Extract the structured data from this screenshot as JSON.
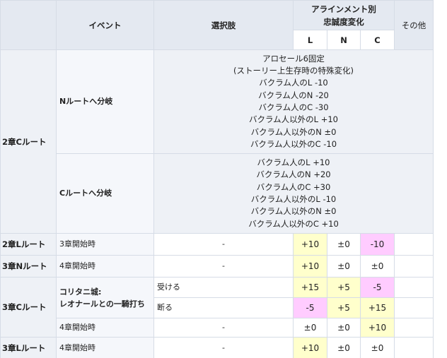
{
  "header": {
    "event": "イベント",
    "choice": "選択肢",
    "alignment_line1": "アラインメント別",
    "alignment_line2": "忠誠度変化",
    "other": "その他",
    "col_l": "L",
    "col_n": "N",
    "col_c": "C"
  },
  "sections": {
    "ch2_c_route": "2章Cルート",
    "ch2_l_route": "2章Lルート",
    "ch3_n_route": "3章Nルート",
    "ch3_c_route": "3章Cルート",
    "ch3_l_route": "3章Lルート"
  },
  "events": {
    "n_route_branch": "Nルートへ分岐",
    "c_route_branch": "Cルートへ分岐",
    "ch3_start": "3章開始時",
    "ch4_start_a": "4章開始時",
    "koritani_line1": "コリタニ城:",
    "koritani_line2": "レオナールとの一騎打ち",
    "ch4_start_b": "4章開始時",
    "ch4_start_c": "4章開始時"
  },
  "notes": {
    "n_branch": [
      "アロセール6固定",
      "(ストーリー上生存時の特殊変化)",
      "バクラム人のL -10",
      "バクラム人のN -20",
      "バクラム人のC -30",
      "バクラム人以外のL +10",
      "バクラム人以外のN ±0",
      "バクラム人以外のC -10"
    ],
    "c_branch": [
      "バクラム人のL +10",
      "バクラム人のN +20",
      "バクラム人のC +30",
      "バクラム人以外のL -10",
      "バクラム人以外のN ±0",
      "バクラム人以外のC +10"
    ]
  },
  "choices": {
    "dash": "-",
    "accept": "受ける",
    "refuse": "断る"
  },
  "rows": {
    "r_ch2l": {
      "l": "+10",
      "n": "±0",
      "c": "-10"
    },
    "r_ch3n": {
      "l": "+10",
      "n": "±0",
      "c": "±0"
    },
    "r_accept": {
      "l": "+15",
      "n": "+5",
      "c": "-5"
    },
    "r_refuse": {
      "l": "-5",
      "n": "+5",
      "c": "+15"
    },
    "r_ch4c": {
      "l": "±0",
      "n": "±0",
      "c": "+10"
    },
    "r_ch3l": {
      "l": "+10",
      "n": "±0",
      "c": "±0"
    }
  },
  "colors": {
    "header_bg": "#e4e9f1",
    "highlight_yellow": "#ffffcc",
    "highlight_pink": "#ffccff",
    "grid_border": "#d6dce6"
  }
}
